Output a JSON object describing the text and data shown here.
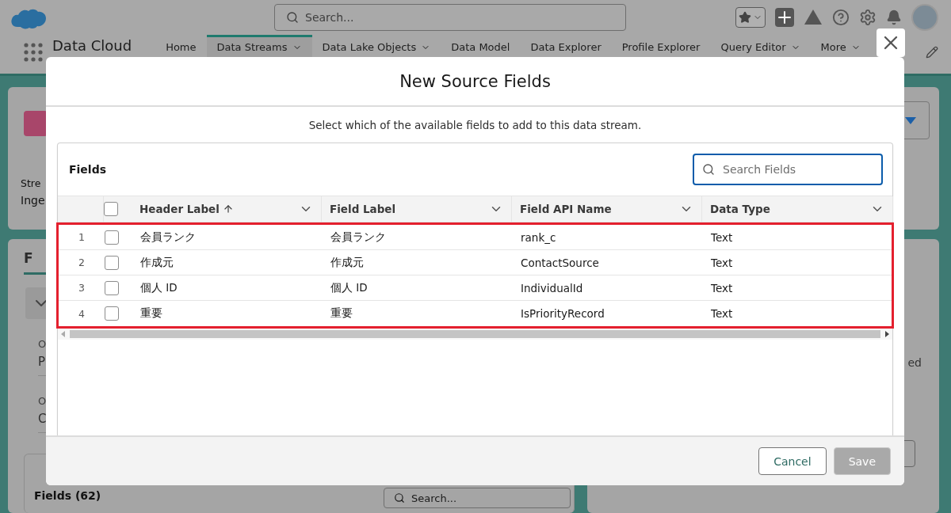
{
  "header": {
    "search_placeholder": "Search..."
  },
  "nav": {
    "app_name": "Data Cloud",
    "tabs": [
      {
        "label": "Home",
        "selected": false,
        "has_menu": false
      },
      {
        "label": "Data Streams",
        "selected": true,
        "has_menu": true
      },
      {
        "label": "Data Lake Objects",
        "selected": false,
        "has_menu": true
      },
      {
        "label": "Data Model",
        "selected": false,
        "has_menu": false
      },
      {
        "label": "Data Explorer",
        "selected": false,
        "has_menu": false
      },
      {
        "label": "Profile Explorer",
        "selected": false,
        "has_menu": false
      },
      {
        "label": "Query Editor",
        "selected": false,
        "has_menu": true
      },
      {
        "label": "More",
        "selected": false,
        "has_menu": true
      }
    ]
  },
  "background": {
    "stream_label": "Stre",
    "stream_value": "Inge",
    "tab_label": "F",
    "detail_labels": [
      "O",
      "O"
    ],
    "detail_values": [
      "P",
      "C"
    ],
    "side_text": "ed",
    "fields_title": "Fields (62)",
    "fields_search_placeholder": "Search..."
  },
  "modal": {
    "title": "New Source Fields",
    "subtitle": "Select which of the available fields to add to this data stream.",
    "card_title": "Fields",
    "search_placeholder": "Search Fields",
    "search_focused": true,
    "all_checked": false,
    "rows_highlighted": true,
    "columns": [
      {
        "label": "Header Label",
        "sorted": true
      },
      {
        "label": "Field Label",
        "sorted": false
      },
      {
        "label": "Field API Name",
        "sorted": false
      },
      {
        "label": "Data Type",
        "sorted": false
      }
    ],
    "rows": [
      {
        "index": "1",
        "checked": false,
        "cells": [
          "会員ランク",
          "会員ランク",
          "rank_c",
          "Text"
        ]
      },
      {
        "index": "2",
        "checked": false,
        "cells": [
          "作成元",
          "作成元",
          "ContactSource",
          "Text"
        ]
      },
      {
        "index": "3",
        "checked": false,
        "cells": [
          "個人 ID",
          "個人 ID",
          "IndividualId",
          "Text"
        ]
      },
      {
        "index": "4",
        "checked": false,
        "cells": [
          "重要",
          "重要",
          "IsPriorityRecord",
          "Text"
        ]
      }
    ],
    "buttons": [
      {
        "label": "Cancel",
        "disabled": false
      },
      {
        "label": "Save",
        "disabled": true
      }
    ]
  }
}
